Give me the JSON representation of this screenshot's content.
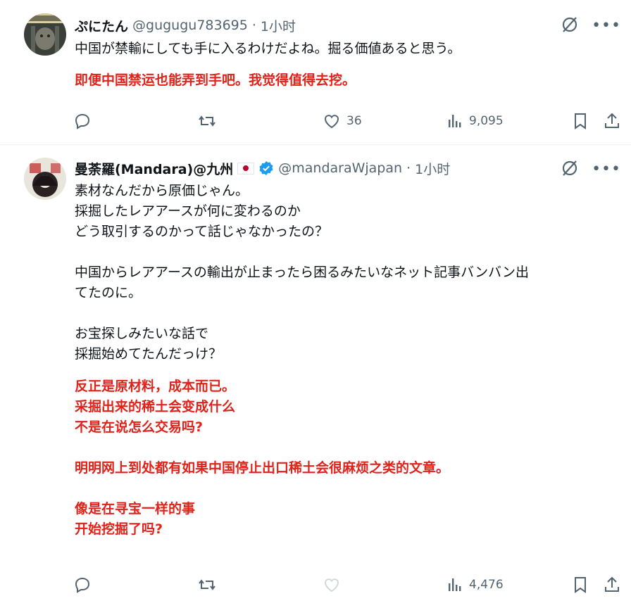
{
  "posts": [
    {
      "author": "ぷにたん",
      "handle": "@gugugu783695",
      "separator": "·",
      "time": "1小时",
      "lines": [
        "中国が禁輸にしても手に入るわけだよね。掘る価値あると思う。"
      ],
      "translation": [
        "即便中国禁运也能弄到手吧。我觉得值得去挖。"
      ],
      "likes": "36",
      "views": "9,095"
    },
    {
      "author": "曼荼羅(Mandara)@九州",
      "handle": "@mandaraWjapan",
      "separator": "·",
      "time": "1小时",
      "lines": [
        "素材なんだから原価じゃん。",
        "採掘したレアアースが何に変わるのか",
        "どう取引するのかって話じゃなかったの？",
        "",
        "中国からレアアースの輸出が止まったら困るみたいなネット記事バンバン出",
        "てたのに。",
        "",
        "お宝探しみたいな話で",
        "採掘始めてたんだっけ？"
      ],
      "translation": [
        "反正是原材料，成本而已。",
        "采掘出来的稀土会变成什么",
        "不是在说怎么交易吗?",
        "",
        "明明网上到处都有如果中国停止出口稀土会很麻烦之类的文章。",
        "",
        "像是在寻宝一样的事",
        "开始挖掘了吗?"
      ],
      "likes": "",
      "views": "4,476"
    }
  ],
  "icons": [
    "reply-icon",
    "retweet-icon",
    "like-icon",
    "views-icon",
    "bookmark-icon",
    "share-icon",
    "grok-icon",
    "more-icon",
    "verified-icon",
    "japan-flag-icon"
  ],
  "colors": {
    "accent": "#1d9bf0",
    "translation": "#e0221a",
    "muted": "#536471"
  }
}
